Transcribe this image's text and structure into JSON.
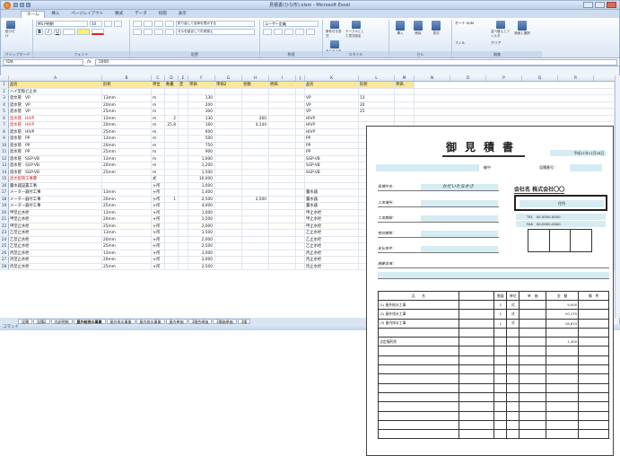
{
  "window": {
    "title": "見積書(ひな形).xlsm - Microsoft Excel"
  },
  "ribbon": {
    "tabs": [
      "ホーム",
      "挿入",
      "ページレイアウト",
      "数式",
      "データ",
      "校閲",
      "表示"
    ],
    "font_name": "MS P明朝",
    "font_size": "10",
    "groups": [
      "クリップボード",
      "フォント",
      "配置",
      "数値",
      "スタイル",
      "セル",
      "編集"
    ],
    "wrap_text": "折り返して全体を表示する",
    "merge_center": "セルを結合して中央揃え",
    "number_format": "ユーザー定義",
    "paste": "貼り付け",
    "cond_format": "条件付き書式",
    "table_format": "テーブルとして書式設定",
    "cell_style": "セルのスタイル",
    "insert": "挿入",
    "delete": "削除",
    "format": "書式",
    "autosum": "オート SUM",
    "fill": "フィル",
    "clear": "クリア",
    "sort": "並べ替えとフィルタ",
    "find": "検索と選択"
  },
  "formula_bar": {
    "name_box": "ID4",
    "fx": "fx",
    "value": "1000"
  },
  "columns": [
    "A",
    "B",
    "C",
    "D",
    "E",
    "F",
    "G",
    "H",
    "I",
    "J",
    "K",
    "L",
    "M",
    "N",
    "O",
    "P",
    "Q",
    "R"
  ],
  "headers": {
    "a": "品名",
    "b": "形状",
    "c": "単位",
    "d": "数量",
    "e": "定",
    "f": "単価",
    "g": "単価2",
    "h": "金額",
    "i": "原価",
    "k": "品名",
    "l": "形状",
    "m": "単価"
  },
  "rows": [
    {
      "n": "2",
      "a": "ハイ型塩ビ止水",
      "b": "",
      "c": "",
      "d": "",
      "f": "",
      "g": "",
      "h": "",
      "k": "",
      "l": "",
      "red": false
    },
    {
      "n": "3",
      "a": "遮水管　VP",
      "b": "13mm",
      "c": "m",
      "d": "",
      "f": "130",
      "g": "",
      "h": "",
      "k": "VP",
      "l": "13",
      "red": false
    },
    {
      "n": "4",
      "a": "遮水管　VP",
      "b": "20mm",
      "c": "m",
      "d": "",
      "f": "200",
      "g": "",
      "h": "",
      "k": "VP",
      "l": "20",
      "red": false
    },
    {
      "n": "5",
      "a": "遮水管　VP",
      "b": "25mm",
      "c": "m",
      "d": "",
      "f": "300",
      "g": "",
      "h": "",
      "k": "VP",
      "l": "25",
      "red": false
    },
    {
      "n": "6",
      "a": "遮水管　HIVP",
      "b": "13mm",
      "c": "m",
      "d": "2",
      "f": "130",
      "g": "",
      "h": "260",
      "k": "HIVP",
      "l": "",
      "red": true
    },
    {
      "n": "7",
      "a": "遮水管　HIVP",
      "b": "20mm",
      "c": "m",
      "d": "25.8",
      "f": "160",
      "g": "",
      "h": "4,144",
      "k": "HIVP",
      "l": "",
      "red": true
    },
    {
      "n": "8",
      "a": "遮水管　HIVP",
      "b": "25mm",
      "c": "m",
      "d": "",
      "f": "600",
      "g": "",
      "h": "",
      "k": "HIVP",
      "l": "",
      "red": false
    },
    {
      "n": "9",
      "a": "遮水管　PP",
      "b": "13mm",
      "c": "m",
      "d": "",
      "f": "500",
      "g": "",
      "h": "",
      "k": "PP",
      "l": "",
      "red": false
    },
    {
      "n": "10",
      "a": "遮水管　PP",
      "b": "20mm",
      "c": "m",
      "d": "",
      "f": "750",
      "g": "",
      "h": "",
      "k": "PP",
      "l": "",
      "red": false
    },
    {
      "n": "11",
      "a": "遮水管　PP",
      "b": "25mm",
      "c": "m",
      "d": "",
      "f": "900",
      "g": "",
      "h": "",
      "k": "PP",
      "l": "",
      "red": false
    },
    {
      "n": "12",
      "a": "遮水管　SGP-VB",
      "b": "13mm",
      "c": "m",
      "d": "",
      "f": "1,000",
      "g": "",
      "h": "",
      "k": "SGP-VB",
      "l": "",
      "red": false
    },
    {
      "n": "13",
      "a": "遮水管　SGP-VB",
      "b": "20mm",
      "c": "m",
      "d": "",
      "f": "1,200",
      "g": "",
      "h": "",
      "k": "SGP-VB",
      "l": "",
      "red": false
    },
    {
      "n": "14",
      "a": "遮水管　SGP-VB",
      "b": "25mm",
      "c": "m",
      "d": "",
      "f": "1,500",
      "g": "",
      "h": "",
      "k": "SGP-VB",
      "l": "",
      "red": false
    },
    {
      "n": "15",
      "a": "遮水配管工事費",
      "b": "",
      "c": "式",
      "d": "",
      "f": "10,000",
      "g": "",
      "h": "",
      "k": "",
      "l": "",
      "red": true
    },
    {
      "n": "16",
      "a": "量水器設置工事",
      "b": "",
      "c": "ヶ所",
      "d": "",
      "f": "1,000",
      "g": "",
      "h": "",
      "k": "",
      "l": "",
      "red": false
    },
    {
      "n": "17",
      "a": "メーター器付工事",
      "b": "13mm",
      "c": "ヶ所",
      "d": "",
      "f": "1,400",
      "g": "",
      "h": "",
      "k": "量水器",
      "l": "",
      "red": false
    },
    {
      "n": "18",
      "a": "メーター器付工事",
      "b": "20mm",
      "c": "ヶ所",
      "d": "1",
      "f": "2,500",
      "g": "",
      "h": "2,500",
      "k": "量水器",
      "l": "",
      "red": false
    },
    {
      "n": "19",
      "a": "メーター器付工事",
      "b": "25mm",
      "c": "ヶ所",
      "d": "",
      "f": "4,000",
      "g": "",
      "h": "",
      "k": "量水器",
      "l": "",
      "red": false
    },
    {
      "n": "20",
      "a": "甲型止水栓",
      "b": "13mm",
      "c": "ヶ所",
      "d": "",
      "f": "1,000",
      "g": "",
      "h": "",
      "k": "甲止水栓",
      "l": "",
      "red": false
    },
    {
      "n": "21",
      "a": "甲型止水栓",
      "b": "20mm",
      "c": "ヶ所",
      "d": "",
      "f": "1,500",
      "g": "",
      "h": "",
      "k": "甲止水栓",
      "l": "",
      "red": false
    },
    {
      "n": "22",
      "a": "甲型止水栓",
      "b": "25mm",
      "c": "ヶ所",
      "d": "",
      "f": "2,000",
      "g": "",
      "h": "",
      "k": "甲止水栓",
      "l": "",
      "red": false
    },
    {
      "n": "23",
      "a": "乙型止水栓",
      "b": "13mm",
      "c": "ヶ所",
      "d": "",
      "f": "1,500",
      "g": "",
      "h": "",
      "k": "乙止水栓",
      "l": "",
      "red": false
    },
    {
      "n": "24",
      "a": "乙型止水栓",
      "b": "20mm",
      "c": "ヶ所",
      "d": "",
      "f": "2,000",
      "g": "",
      "h": "",
      "k": "乙止水栓",
      "l": "",
      "red": false
    },
    {
      "n": "25",
      "a": "乙型止水栓",
      "b": "25mm",
      "c": "ヶ所",
      "d": "",
      "f": "2,500",
      "g": "",
      "h": "",
      "k": "乙止水栓",
      "l": "",
      "red": false
    },
    {
      "n": "26",
      "a": "丙型止水栓",
      "b": "13mm",
      "c": "ヶ所",
      "d": "",
      "f": "3,000",
      "g": "",
      "h": "",
      "k": "丙止水栓",
      "l": "",
      "red": false
    },
    {
      "n": "27",
      "a": "丙型止水栓",
      "b": "20mm",
      "c": "ヶ所",
      "d": "",
      "f": "2,000",
      "g": "",
      "h": "",
      "k": "丙止水栓",
      "l": "",
      "red": false
    },
    {
      "n": "28",
      "a": "丙型止水栓",
      "b": "25mm",
      "c": "ヶ所",
      "d": "",
      "f": "2,500",
      "g": "",
      "h": "",
      "k": "丙止水栓",
      "l": "",
      "red": false
    }
  ],
  "sheet_tabs": [
    "見積",
    "見積2",
    "内訳明細",
    "屋外給排水事業",
    "屋外排水事業",
    "屋内排水事業",
    "屋内単価",
    "3場合単価",
    "3場価単価",
    "3場"
  ],
  "status": "コマンド",
  "quote": {
    "title": "御見積書",
    "date": "平成21年11月18日",
    "no_label": "御中",
    "mgmt_label": "見積番号：",
    "fields": [
      {
        "label": "見積件名：",
        "value": "かだいたなかさ"
      },
      {
        "label": "工事場所：",
        "value": ""
      },
      {
        "label": "工事期間：",
        "value": ""
      },
      {
        "label": "有効期限：",
        "value": ""
      },
      {
        "label": "支払条件：",
        "value": ""
      }
    ],
    "company": "会社名 株式会社〇〇",
    "stamp": "住所",
    "tel": "TEL　00-0000-0000",
    "fax": "FAX　00-0000-0000",
    "remark_label": "摘要事項：",
    "table_headers": [
      "品　　名",
      "",
      "数量",
      "単位",
      "単　価",
      "金　額",
      "備　考"
    ],
    "items": [
      {
        "name": "(1) 屋外給水工事",
        "qty": "1",
        "unit": "式",
        "amount": "9,000"
      },
      {
        "name": "(2) 屋外排水工事",
        "qty": "1",
        "unit": "式",
        "amount": "10,170"
      },
      {
        "name": "(3) 屋内排水工事",
        "qty": "1",
        "unit": "式",
        "amount": "18,870"
      },
      {
        "name": "",
        "qty": "",
        "unit": "",
        "amount": ""
      },
      {
        "name": "法定福利費",
        "qty": "",
        "unit": "",
        "amount": "1,300"
      }
    ]
  }
}
